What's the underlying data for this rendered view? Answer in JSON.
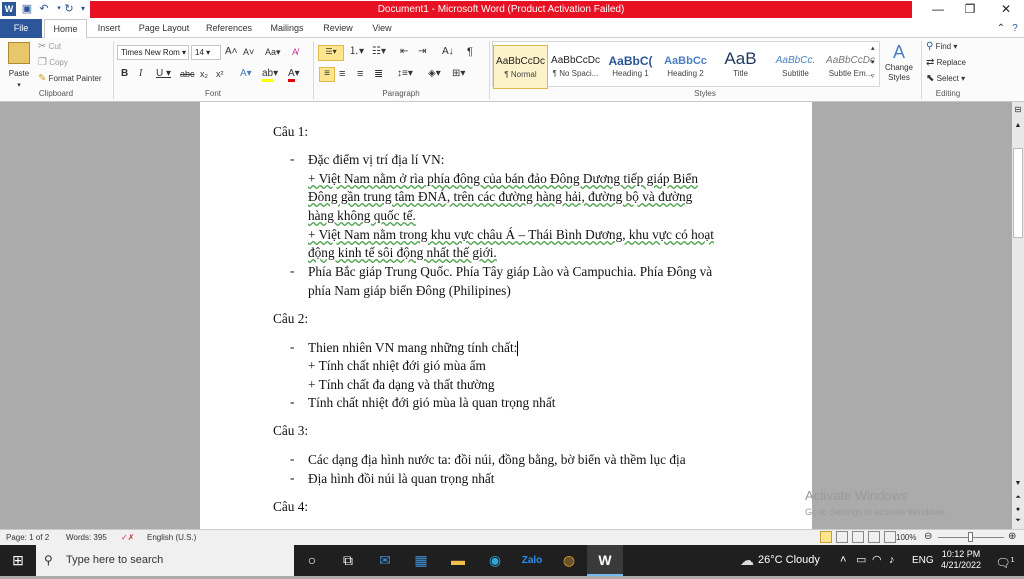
{
  "window": {
    "title": "Document1  -  Microsoft Word (Product Activation Failed)",
    "minimize": "—",
    "maximize": "❐",
    "close": "✕"
  },
  "tabs": [
    {
      "label": "File"
    },
    {
      "label": "Home"
    },
    {
      "label": "Insert"
    },
    {
      "label": "Page Layout"
    },
    {
      "label": "References"
    },
    {
      "label": "Mailings"
    },
    {
      "label": "Review"
    },
    {
      "label": "View"
    }
  ],
  "ribbon": {
    "clipboard": {
      "paste": "Paste",
      "cut": "Cut",
      "copy": "Copy",
      "format_painter": "Format Painter",
      "label": "Clipboard"
    },
    "font": {
      "font_name": "Times New Rom",
      "font_size": "14",
      "label": "Font"
    },
    "paragraph": {
      "label": "Paragraph"
    },
    "styles": {
      "items": [
        {
          "preview": "AaBbCcDc",
          "name": "¶ Normal"
        },
        {
          "preview": "AaBbCcDc",
          "name": "¶ No Spaci..."
        },
        {
          "preview": "AaBbC(",
          "name": "Heading 1"
        },
        {
          "preview": "AaBbCc",
          "name": "Heading 2"
        },
        {
          "preview": "AaB",
          "name": "Title"
        },
        {
          "preview": "AaBbCc.",
          "name": "Subtitle"
        },
        {
          "preview": "AaBbCcDc",
          "name": "Subtle Em..."
        }
      ],
      "change_styles": "Change Styles",
      "label": "Styles"
    },
    "editing": {
      "find": "Find",
      "replace": "Replace",
      "select": "Select",
      "label": "Editing"
    }
  },
  "document": {
    "q1": "Câu 1:",
    "q1_l1": "Đặc điểm vị trí địa lí VN:",
    "q1_l2": "+ Việt Nam nằm ở rìa phía đông của bán đảo Đông Dương tiếp giáp Biển",
    "q1_l3": "Đông gần trung tâm ĐNÁ, trên các đường hàng hải, đường bộ và đường",
    "q1_l4": "hàng không quốc tế.",
    "q1_l5": "+ Việt Nam nằm trong khu vực châu Á – Thái Bình Dương, khu vực có hoạt",
    "q1_l6": "động kinh tế sôi động nhất thế giới.",
    "q1_l7": "Phía Bắc giáp Trung Quốc. Phía Tây giáp Lào và Campuchia. Phía Đông và",
    "q1_l8": "phía Nam giáp biển Đông (Philipines)",
    "q2": "Câu 2:",
    "q2_l1": "Thien nhiên VN mang những tính chất:",
    "q2_l2": "+ Tính chất nhiệt đới gió mùa ẩm",
    "q2_l3": "+ Tính chất đa dạng và thất thường",
    "q2_l4": "Tính chất nhiệt đới gió mùa là quan trọng nhất",
    "q3": "Câu 3:",
    "q3_l1": "Các dạng địa hình nước ta: đồi núi, đồng bằng, bờ biển và thềm lục địa",
    "q3_l2": "Địa hình đồi núi là quan trọng nhất",
    "q4": "Câu 4:",
    "bullet": "-"
  },
  "statusbar": {
    "page": "Page: 1 of 2",
    "words": "Words: 395",
    "language": "English (U.S.)",
    "zoom": "100%"
  },
  "watermark": {
    "title": "Activate Windows",
    "subtitle": "Go to Settings to activate Windows."
  },
  "taskbar": {
    "search_placeholder": "Type here to search",
    "weather": "26°C  Cloudy",
    "lang": "ENG",
    "time": "10:12 PM",
    "date": "4/21/2022",
    "notifications": "1"
  }
}
